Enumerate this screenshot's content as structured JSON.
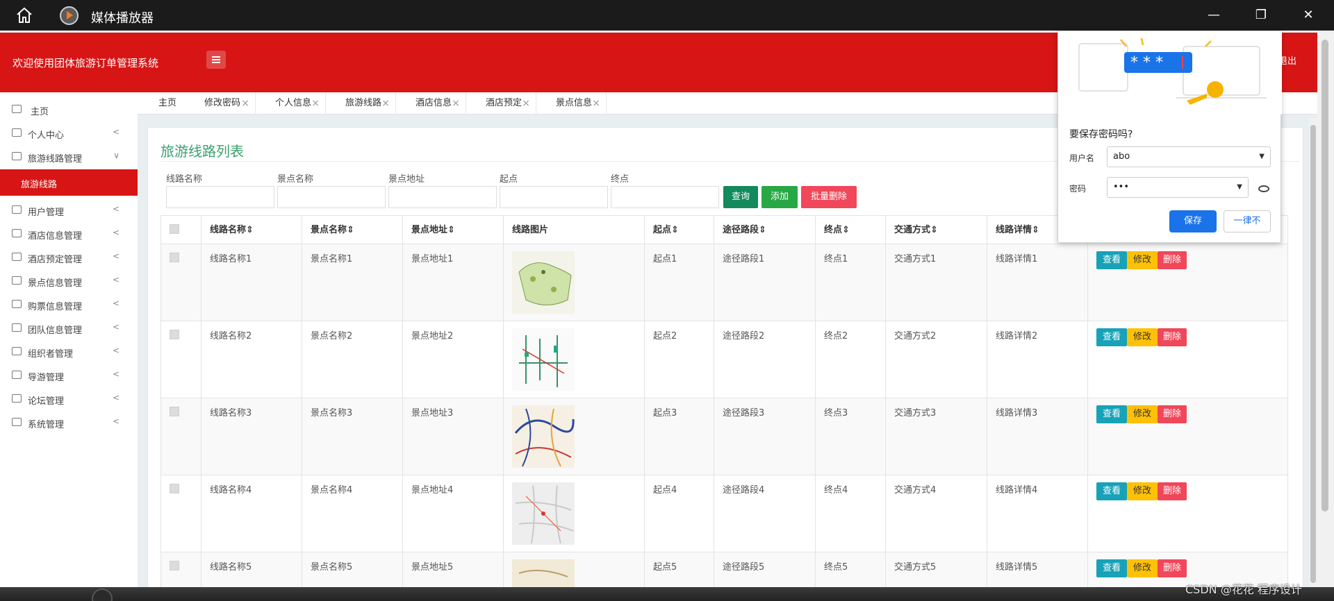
{
  "window": {
    "title": "媒体播放器",
    "home_icon": "home-icon",
    "minimize": "—",
    "restore": "❐",
    "close": "✕"
  },
  "header": {
    "brand": "欢迎使用团体旅游订单管理系统",
    "logout": "退出"
  },
  "sidebar": {
    "items": [
      {
        "label": "主页",
        "icon": "dashboard-icon"
      },
      {
        "label": "个人中心",
        "icon": "user-icon",
        "chevron": "<"
      },
      {
        "label": "旅游线路管理",
        "icon": "user-icon",
        "chevron": "∨"
      },
      {
        "label": "旅游线路",
        "submenu": true
      },
      {
        "label": "用户管理",
        "icon": "user-icon",
        "chevron": "<"
      },
      {
        "label": "酒店信息管理",
        "icon": "user-icon",
        "chevron": "<"
      },
      {
        "label": "酒店预定管理",
        "icon": "user-icon",
        "chevron": "<"
      },
      {
        "label": "景点信息管理",
        "icon": "user-icon",
        "chevron": "<"
      },
      {
        "label": "购票信息管理",
        "icon": "user-icon",
        "chevron": "<"
      },
      {
        "label": "团队信息管理",
        "icon": "user-icon",
        "chevron": "<"
      },
      {
        "label": "组织者管理",
        "icon": "user-icon",
        "chevron": "<"
      },
      {
        "label": "导游管理",
        "icon": "user-icon",
        "chevron": "<"
      },
      {
        "label": "论坛管理",
        "icon": "user-icon",
        "chevron": "<"
      },
      {
        "label": "系统管理",
        "icon": "user-icon",
        "chevron": "<"
      }
    ]
  },
  "tabs": [
    {
      "label": "主页",
      "closable": false
    },
    {
      "label": "修改密码",
      "closable": true
    },
    {
      "label": "个人信息",
      "closable": true
    },
    {
      "label": "旅游线路",
      "closable": true
    },
    {
      "label": "酒店信息",
      "closable": true
    },
    {
      "label": "酒店预定",
      "closable": true
    },
    {
      "label": "景点信息",
      "closable": true
    }
  ],
  "page": {
    "title": "旅游线路列表",
    "filters": [
      {
        "label": "线路名称",
        "placeholder": ""
      },
      {
        "label": "景点名称",
        "placeholder": ""
      },
      {
        "label": "景点地址",
        "placeholder": ""
      },
      {
        "label": "起点",
        "placeholder": ""
      },
      {
        "label": "终点",
        "placeholder": ""
      }
    ],
    "buttons": {
      "query": "查询",
      "add": "添加",
      "batch_delete": "批量删除"
    },
    "columns": [
      "线路名称",
      "景点名称",
      "景点地址",
      "线路图片",
      "起点",
      "途径路段",
      "终点",
      "交通方式",
      "线路详情"
    ],
    "rows": [
      {
        "name": "线路名称1",
        "spot": "景点名称1",
        "addr": "景点地址1",
        "start": "起点1",
        "via": "途径路段1",
        "end": "终点1",
        "transport": "交通方式1",
        "detail": "线路详情1"
      },
      {
        "name": "线路名称2",
        "spot": "景点名称2",
        "addr": "景点地址2",
        "start": "起点2",
        "via": "途径路段2",
        "end": "终点2",
        "transport": "交通方式2",
        "detail": "线路详情2"
      },
      {
        "name": "线路名称3",
        "spot": "景点名称3",
        "addr": "景点地址3",
        "start": "起点3",
        "via": "途径路段3",
        "end": "终点3",
        "transport": "交通方式3",
        "detail": "线路详情3"
      },
      {
        "name": "线路名称4",
        "spot": "景点名称4",
        "addr": "景点地址4",
        "start": "起点4",
        "via": "途径路段4",
        "end": "终点4",
        "transport": "交通方式4",
        "detail": "线路详情4"
      },
      {
        "name": "线路名称5",
        "spot": "景点名称5",
        "addr": "景点地址5",
        "start": "起点5",
        "via": "途径路段5",
        "end": "终点5",
        "transport": "交通方式5",
        "detail": "线路详情5"
      }
    ],
    "actions": {
      "view": "查看",
      "edit": "修改",
      "delete": "删除"
    }
  },
  "password_popup": {
    "question": "要保存密码吗?",
    "username_label": "用户名",
    "username_value": "abo",
    "password_label": "密码",
    "password_value": "•••",
    "save": "保存",
    "never": "一律不",
    "stars": "* * *"
  },
  "watermark": "CSDN @花花 程序设计",
  "colors": {
    "brand_red": "#d71515",
    "accent_green": "#3ca06f",
    "info": "#17a2b8",
    "warning": "#ffc107",
    "danger": "#f0475a",
    "primary_blue": "#1a73e8"
  }
}
